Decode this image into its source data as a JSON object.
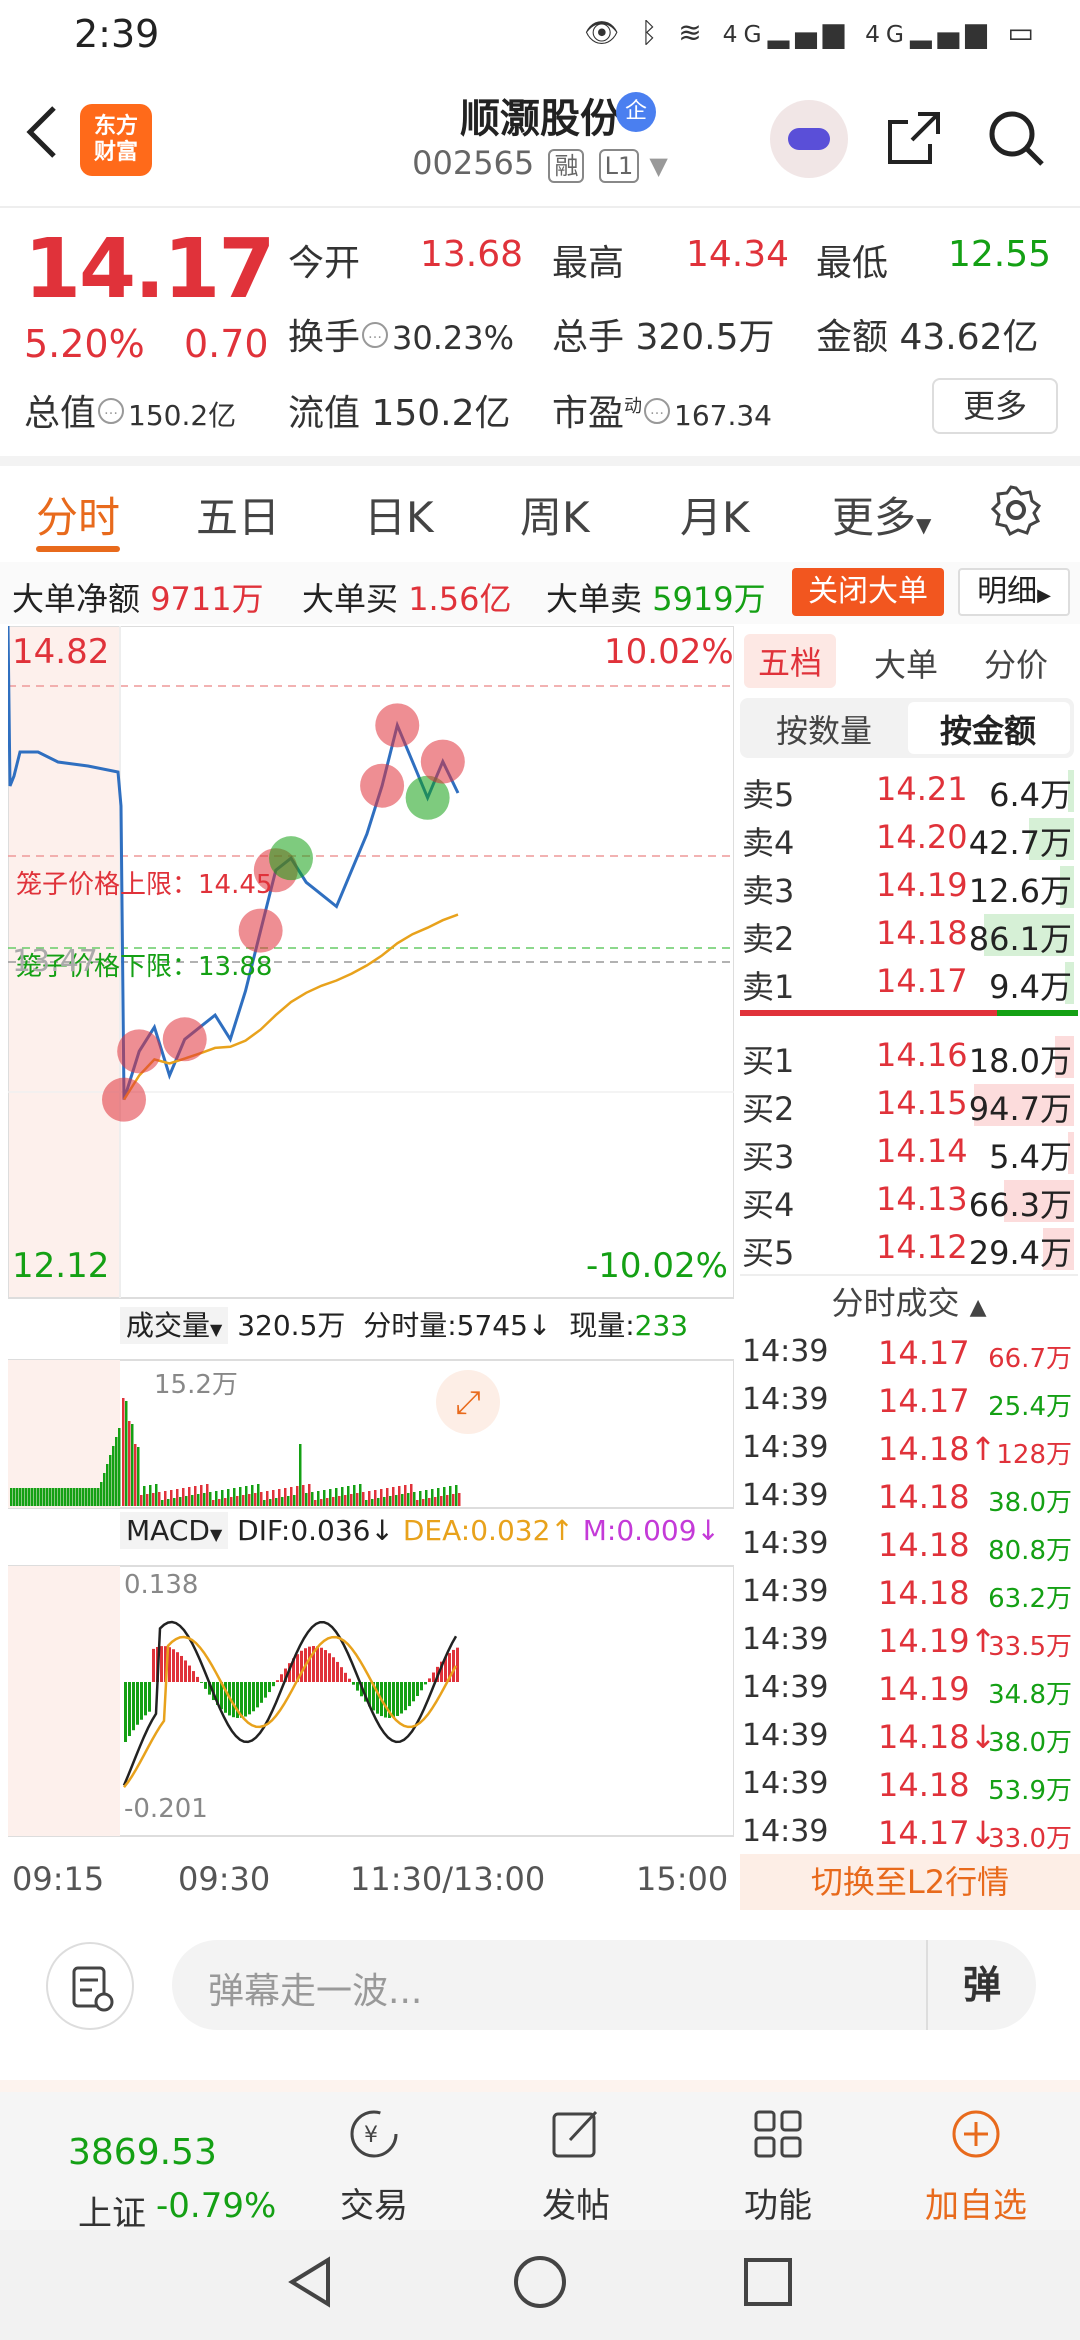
{
  "status_bar": {
    "time": "2:39",
    "signal_label_1": "4G",
    "signal_label_2": "4G"
  },
  "header": {
    "logo_line1": "东方",
    "logo_line2": "财富",
    "stock_name": "顺灏股份",
    "company_badge": "企",
    "stock_code": "002565",
    "tag_margin": "融",
    "tag_level": "L1"
  },
  "quote": {
    "price": "14.17",
    "change_pct": "5.20%",
    "change_val": "0.70",
    "open_label": "今开",
    "open": "13.68",
    "high_label": "最高",
    "high": "14.34",
    "low_label": "最低",
    "low": "12.55",
    "turnover_label": "换手",
    "turnover": "30.23%",
    "volume_label": "总手",
    "volume": "320.5万",
    "amount_label": "金额",
    "amount": "43.62亿",
    "mktcap_label": "总值",
    "mktcap": "150.2亿",
    "float_label": "流值",
    "float_cap": "150.2亿",
    "pe_label": "市盈",
    "pe_sup": "动",
    "pe": "167.34",
    "more_button": "更多"
  },
  "tabs": {
    "items": [
      "分时",
      "五日",
      "日K",
      "周K",
      "月K",
      "更多"
    ],
    "active": "分时"
  },
  "big_order": {
    "net_label": "大单净额",
    "net": "9711万",
    "buy_label": "大单买",
    "buy": "1.56亿",
    "sell_label": "大单卖",
    "sell": "5919万",
    "close_button": "关闭大单",
    "detail_button": "明细"
  },
  "chart": {
    "price_top": "14.82",
    "pct_top": "10.02%",
    "price_mid": "13.47",
    "price_bottom": "12.12",
    "pct_bottom": "-10.02%",
    "cage_upper": "笼子价格上限：14.45",
    "cage_lower": "笼子价格下限：13.88",
    "volume_label": "成交量",
    "volume_total": "320.5万",
    "volume_time": "分时量:5745",
    "volume_now_label": "现量:",
    "volume_now": "233",
    "volume_max": "15.2万",
    "macd_label": "MACD",
    "dif": "DIF:0.036",
    "dea": "DEA:0.032",
    "m": "M:0.009",
    "macd_top": "0.138",
    "macd_bottom": "-0.201",
    "time_axis": [
      "09:15",
      "09:30",
      "11:30/13:00",
      "15:00"
    ],
    "colors": {
      "price_line": "#2f6fc0",
      "avg_line": "#e8a21c",
      "up": "#e0323a",
      "down": "#14a014"
    }
  },
  "chart_data": {
    "type": "line",
    "title": "",
    "x": [
      "09:30",
      "09:40",
      "09:50",
      "10:00",
      "10:10",
      "10:20",
      "10:30",
      "10:40",
      "10:50",
      "11:00",
      "11:10",
      "11:20",
      "11:30",
      "13:10",
      "13:20",
      "13:30",
      "13:40",
      "13:50",
      "14:00",
      "14:10",
      "14:20",
      "14:30",
      "14:39"
    ],
    "series": [
      {
        "name": "",
        "values": [
          12.9,
          13.1,
          13.2,
          13.0,
          13.15,
          13.2,
          13.25,
          13.15,
          13.35,
          13.6,
          13.85,
          13.9,
          13.8,
          13.75,
          13.7,
          13.85,
          14.0,
          14.2,
          14.45,
          14.3,
          14.15,
          14.3,
          14.17
        ]
      }
    ],
    "ylim": [
      12.12,
      14.82
    ],
    "xlabel": "",
    "ylabel": ""
  },
  "order_book": {
    "tabs": [
      "五档",
      "大单",
      "分价"
    ],
    "seg": [
      "按数量",
      "按金额"
    ],
    "asks": [
      {
        "label": "卖5",
        "price": "14.21",
        "vol": "6.4万",
        "bar": 0.07
      },
      {
        "label": "卖4",
        "price": "14.20",
        "vol": "42.7万",
        "bar": 0.5
      },
      {
        "label": "卖3",
        "price": "14.19",
        "vol": "12.6万",
        "bar": 0.15
      },
      {
        "label": "卖2",
        "price": "14.18",
        "vol": "86.1万",
        "bar": 1.0
      },
      {
        "label": "卖1",
        "price": "14.17",
        "vol": "9.4万",
        "bar": 0.1
      }
    ],
    "bids": [
      {
        "label": "买1",
        "price": "14.16",
        "vol": "18.0万",
        "bar": 0.19
      },
      {
        "label": "买2",
        "price": "14.15",
        "vol": "94.7万",
        "bar": 1.0
      },
      {
        "label": "买3",
        "price": "14.14",
        "vol": "5.4万",
        "bar": 0.06
      },
      {
        "label": "买4",
        "price": "14.13",
        "vol": "66.3万",
        "bar": 0.7
      },
      {
        "label": "买5",
        "price": "14.12",
        "vol": "29.4万",
        "bar": 0.31
      }
    ],
    "ticks_title": "分时成交",
    "ticks": [
      {
        "t": "14:39",
        "p": "14.17",
        "v": "66.7万",
        "pc": "red",
        "vc": "red"
      },
      {
        "t": "14:39",
        "p": "14.17",
        "v": "25.4万",
        "pc": "red",
        "vc": "green"
      },
      {
        "t": "14:39",
        "p": "14.18↑",
        "v": "128万",
        "pc": "red",
        "vc": "red"
      },
      {
        "t": "14:39",
        "p": "14.18",
        "v": "38.0万",
        "pc": "red",
        "vc": "green"
      },
      {
        "t": "14:39",
        "p": "14.18",
        "v": "80.8万",
        "pc": "red",
        "vc": "green"
      },
      {
        "t": "14:39",
        "p": "14.18",
        "v": "63.2万",
        "pc": "red",
        "vc": "green"
      },
      {
        "t": "14:39",
        "p": "14.19↑",
        "v": "33.5万",
        "pc": "red",
        "vc": "red"
      },
      {
        "t": "14:39",
        "p": "14.19",
        "v": "34.8万",
        "pc": "red",
        "vc": "green"
      },
      {
        "t": "14:39",
        "p": "14.18↓",
        "v": "38.0万",
        "pc": "red",
        "vc": "green"
      },
      {
        "t": "14:39",
        "p": "14.18",
        "v": "53.9万",
        "pc": "red",
        "vc": "green"
      },
      {
        "t": "14:39",
        "p": "14.17↓",
        "v": "33.0万",
        "pc": "red",
        "vc": "red"
      }
    ],
    "switch_l2": "切换至L2行情"
  },
  "bullet": {
    "placeholder": "弹幕走一波...",
    "send": "弹"
  },
  "bottom_nav": {
    "index_value": "3869.53",
    "index_name": "上证",
    "index_pct": "-0.79%",
    "items": [
      "交易",
      "发帖",
      "功能",
      "加自选"
    ]
  }
}
